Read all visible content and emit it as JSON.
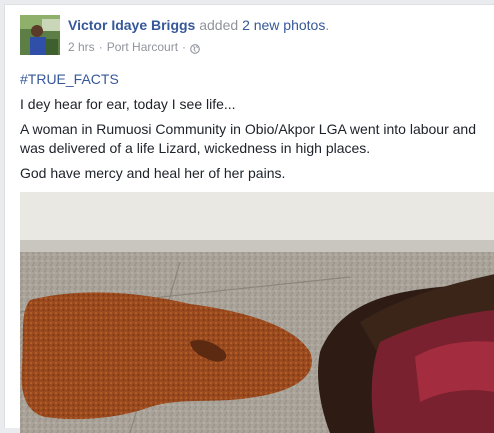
{
  "post": {
    "author": "Victor Idaye Briggs",
    "action_prefix": "added",
    "action_link": "2 new photos",
    "action_suffix": ".",
    "time": "2 hrs",
    "separator": "·",
    "location": "Port Harcourt",
    "audience_icon": "globe-icon",
    "hashtag": "#TRUE_FACTS",
    "paragraphs": [
      "I dey hear for ear, today I see life...",
      "A woman in Rumuosi Community in Obio/Akpor LGA went into labour and was delivered of a life Lizard, wickedness in high places.",
      "God have mercy and heal her of her pains."
    ]
  },
  "colors": {
    "link": "#365899",
    "text": "#1d2129",
    "meta": "#90949c",
    "background": "#e9ebee"
  }
}
